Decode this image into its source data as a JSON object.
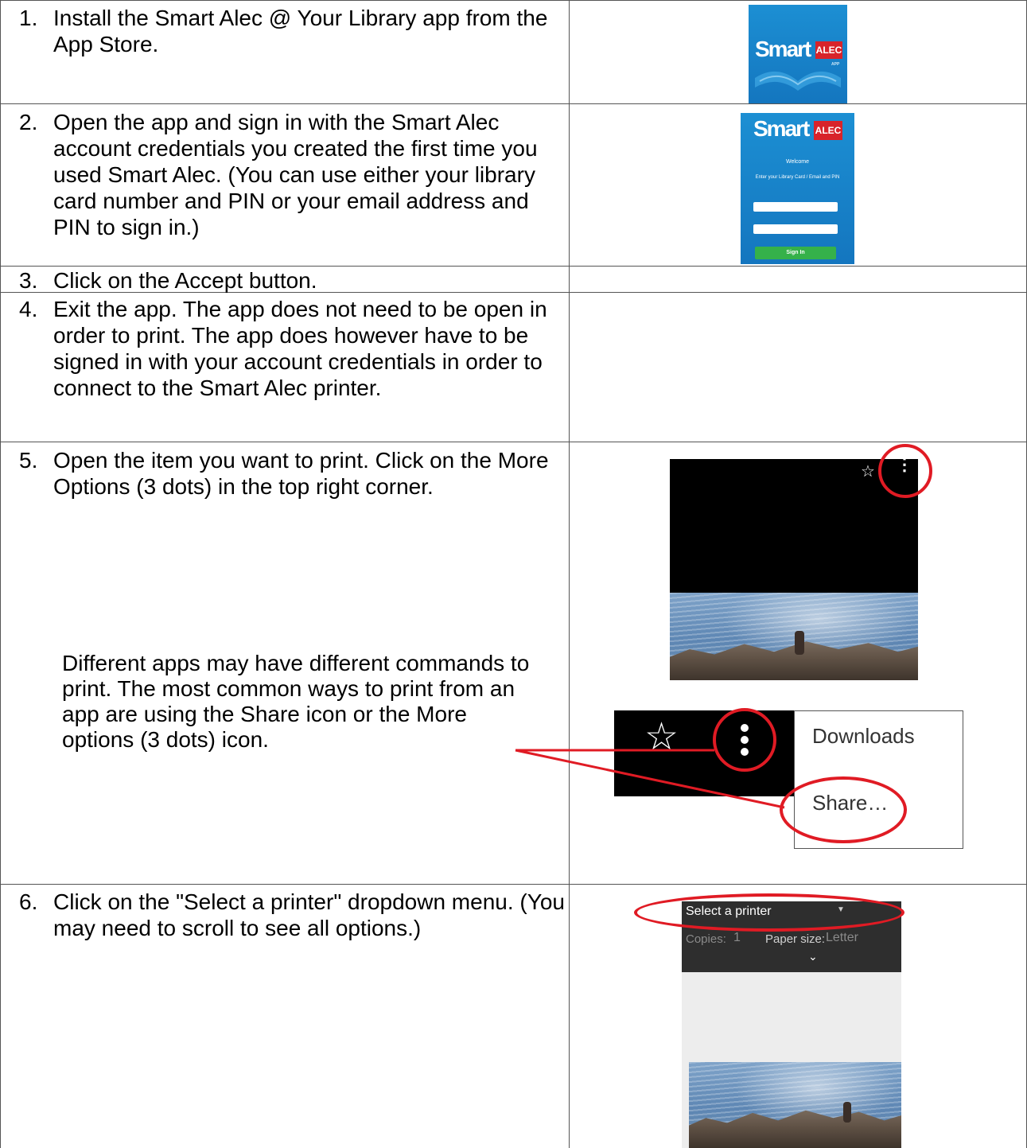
{
  "rows": [
    {
      "number": "1.",
      "text": "Install the Smart Alec @ Your Library app from the App Store."
    },
    {
      "number": "2.",
      "text": "Open the app and sign in with the Smart Alec account credentials you created the first time you used Smart Alec.  (You can use either your library card number and PIN or your email address and PIN to sign in.)"
    },
    {
      "number": "3.",
      "text": "Click on the Accept button."
    },
    {
      "number": "4.",
      "text": "Exit the app. The app does not need to be open in order to print. The app does however have to be signed in with your account credentials in order to connect to the Smart Alec printer."
    },
    {
      "number": "5.",
      "text": "Open the item you want to print. Click on the More Options (3 dots) in the top right corner."
    },
    {
      "number": "6.",
      "text": "Click on the \"Select a printer\" dropdown menu. (You may need to scroll to see all options.)"
    }
  ],
  "note": "Different apps may have different commands to print.  The most common ways to print from an app are using the Share icon or the More options (3 dots) icon.",
  "logo": {
    "word": "Smart",
    "tag": "ALEC",
    "sub": "APP"
  },
  "login": {
    "welcome": "Welcome",
    "prompt": "Enter your Library Card / Email and PIN",
    "button": "Sign In"
  },
  "menu": {
    "item1": "Downloads",
    "item2": "Share…"
  },
  "print_dialog": {
    "select": "Select a printer",
    "copies_label": "Copies:",
    "copies_value": "1",
    "paper_label": "Paper size:",
    "paper_value": "Letter"
  },
  "colors": {
    "ring": "#e01b24",
    "logo_blue": "#1c8fd3",
    "logo_red": "#d8232a",
    "sign_in_green": "#35b14a"
  }
}
